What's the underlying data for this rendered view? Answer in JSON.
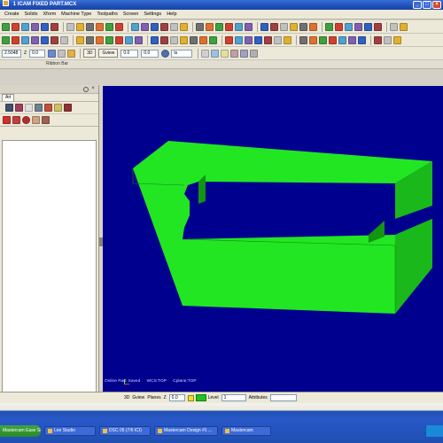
{
  "window": {
    "title": "1 ICAM FIXED PART.MCX",
    "app_icon": "mastercam-icon",
    "minimize": "_",
    "maximize": "□",
    "close": "×"
  },
  "menu": {
    "items": [
      "Create",
      "Solids",
      "Xform",
      "Machine Type",
      "Toolpaths",
      "Screen",
      "Settings",
      "Help"
    ]
  },
  "toolbar3": {
    "fields": [
      "2.5048",
      "Z",
      "0.0"
    ],
    "buttons": [
      "3D",
      "Gview"
    ],
    "boxes": [
      "0.0",
      "0.0",
      "",
      "ts"
    ]
  },
  "ribbon": {
    "label": "Ribbon Bar"
  },
  "left_panel": {
    "tab": "Art",
    "close": "×"
  },
  "viewport": {
    "background": "#00008f",
    "part_color": "#22e622",
    "status": [
      "Online Part: Saved",
      "WCS:TOP",
      "Cplane:TOP"
    ]
  },
  "statusbar": {
    "items": [
      {
        "type": "text",
        "value": "3D"
      },
      {
        "type": "text",
        "value": "Gview"
      },
      {
        "type": "text",
        "value": "Planes"
      },
      {
        "type": "text",
        "value": "Z"
      },
      {
        "type": "field",
        "value": "0.0"
      },
      {
        "type": "text",
        "value": "Level"
      },
      {
        "type": "field",
        "value": "1"
      },
      {
        "type": "text",
        "value": "Attributes"
      },
      {
        "type": "field",
        "value": ""
      }
    ]
  },
  "taskbar": {
    "start": "Mastercam Ease Search",
    "tasks": [
      "Lee Studio",
      "DSC 05 (7/6 ICI)",
      "Mastercam Design #1 ...",
      "Mastercam"
    ]
  }
}
